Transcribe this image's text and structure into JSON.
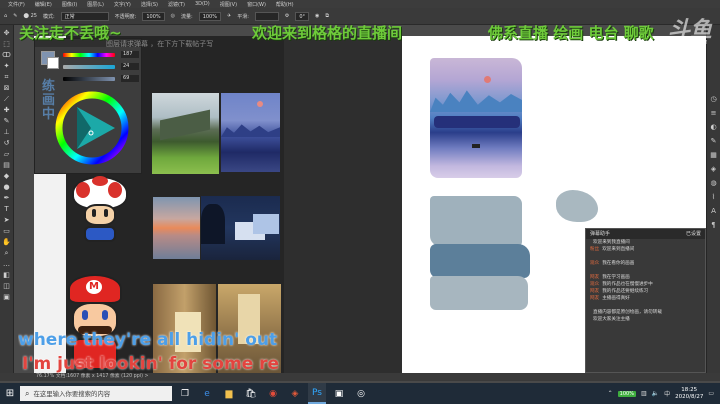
{
  "menu": [
    "文件(F)",
    "编辑(E)",
    "图像(I)",
    "图层(L)",
    "文字(Y)",
    "选择(S)",
    "滤镜(T)",
    "3D(D)",
    "视图(V)",
    "窗口(W)",
    "帮助(H)"
  ],
  "options": {
    "mode_label": "模式:",
    "mode_value": "正常",
    "opacity_label": "不透明度:",
    "opacity_value": "100%",
    "flow_label": "流量:",
    "flow_value": "100%",
    "smooth_label": "平滑:",
    "angle_value": "0°"
  },
  "overlay": {
    "follow_text": "关注走不丢哦~",
    "welcome_text": "欢迎来到格格的直播间",
    "buddha_text": "佛系直播 绘画 电台 聊歌",
    "faint_text": "图层请求弹幕 ，在下方下载帖子写",
    "vertical_text": "练画中",
    "lyric_blue": "where they're all hidin' out",
    "lyric_red": "I'm just lookin' for some re",
    "logo": "斗鱼",
    "logo_sub": "DOUYU.COM"
  },
  "color_panel": {
    "h_value": "187",
    "s_value": "24",
    "b_value": "69"
  },
  "chat": {
    "title": "弹幕助手",
    "title_right": "已设置",
    "lines": [
      {
        "who": "",
        "text": "欢迎来到我直播间"
      },
      {
        "who": "粉丝",
        "text": "欢迎来到直播间"
      },
      {
        "who": "",
        "text": ""
      },
      {
        "who": "观众",
        "text": "我在看你的画画"
      },
      {
        "who": "",
        "text": ""
      },
      {
        "who": "网友",
        "text": "我在学习画画"
      },
      {
        "who": "观众",
        "text": "我的作品也在慢慢进步中"
      },
      {
        "who": "网友",
        "text": "我的作品还要继续练习"
      },
      {
        "who": "网友",
        "text": "主播画得真好"
      },
      {
        "who": "",
        "text": ""
      },
      {
        "who": "",
        "text": "直播内容都是原创绘画，请勿转载"
      },
      {
        "who": "",
        "text": "欢迎大家关注主播"
      }
    ]
  },
  "statusbar": {
    "text": "76.17%   文档:1607 像素 x 1417 像素 (120 ppi)   >"
  },
  "taskbar": {
    "search_placeholder": "在这里输入你要搜索的内容",
    "time": "18:25",
    "date": "2020/8/27",
    "battery": "100%",
    "ime": "中"
  },
  "colors": {
    "overlay_green": "#6ecb3a",
    "lyric_blue": "#4d9fe8",
    "lyric_red": "#e3443f"
  }
}
